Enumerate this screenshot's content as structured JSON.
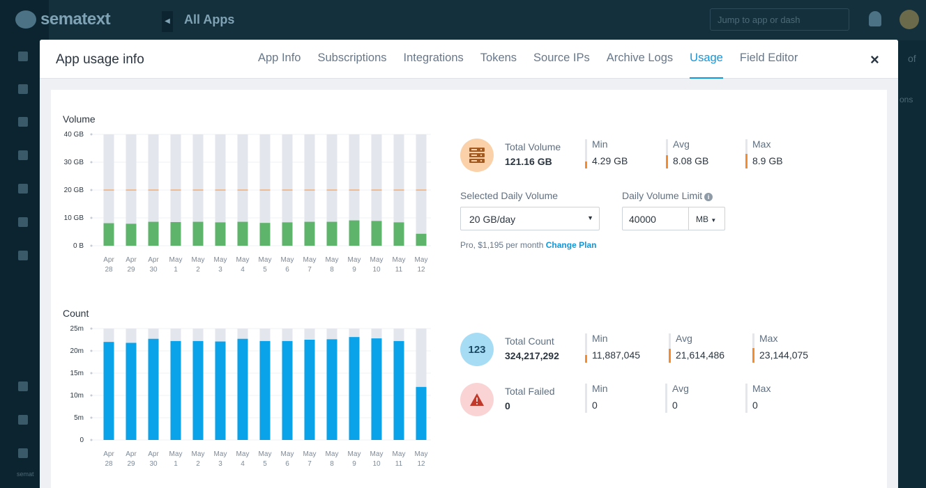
{
  "background": {
    "logo": "sematext",
    "page_title": "All Apps",
    "search_placeholder": "Jump to app or dash",
    "right_text": "of",
    "right_text2": "ons",
    "footer": "semat"
  },
  "modal": {
    "title": "App usage info",
    "tabs": [
      "App Info",
      "Subscriptions",
      "Integrations",
      "Tokens",
      "Source IPs",
      "Archive Logs",
      "Usage",
      "Field Editor"
    ],
    "active_tab": "Usage",
    "close_label": "×"
  },
  "colors": {
    "volume_bar": "#5db46a",
    "count_bar": "#0aa2e8",
    "bar_track": "#e3e6ec",
    "limit_line": "#f5a05a",
    "accent": "#1296db",
    "stat_marker": "#f58b2e"
  },
  "volume": {
    "label": "Volume",
    "stats": {
      "total_title": "Total Volume",
      "total_value": "121.16 GB",
      "min_label": "Min",
      "min_value": "4.29 GB",
      "min_level": 0.48,
      "avg_label": "Avg",
      "avg_value": "8.08 GB",
      "avg_level": 0.91,
      "max_label": "Max",
      "max_value": "8.9 GB",
      "max_level": 1.0
    },
    "icon": "server-icon",
    "selected_daily_label": "Selected Daily Volume",
    "selected_daily_value": "20 GB/day",
    "limit_label": "Daily Volume Limit",
    "limit_value": "40000",
    "limit_unit": "MB",
    "plan_text": "Pro, $1,195 per month",
    "change_plan": "Change Plan"
  },
  "count": {
    "label": "Count",
    "stats": {
      "total_title": "Total Count",
      "total_value": "324,217,292",
      "min_label": "Min",
      "min_value": "11,887,045",
      "min_level": 0.51,
      "avg_label": "Avg",
      "avg_value": "21,614,486",
      "avg_level": 0.93,
      "max_label": "Max",
      "max_value": "23,144,075",
      "max_level": 1.0
    },
    "icon_text": "123",
    "failed": {
      "total_title": "Total Failed",
      "total_value": "0",
      "min_label": "Min",
      "min_value": "0",
      "avg_label": "Avg",
      "avg_value": "0",
      "max_label": "Max",
      "max_value": "0"
    }
  },
  "chart_data": [
    {
      "type": "bar",
      "title": "Volume",
      "categories": [
        [
          "Apr",
          "28"
        ],
        [
          "Apr",
          "29"
        ],
        [
          "Apr",
          "30"
        ],
        [
          "May",
          "1"
        ],
        [
          "May",
          "2"
        ],
        [
          "May",
          "3"
        ],
        [
          "May",
          "4"
        ],
        [
          "May",
          "5"
        ],
        [
          "May",
          "6"
        ],
        [
          "May",
          "7"
        ],
        [
          "May",
          "8"
        ],
        [
          "May",
          "9"
        ],
        [
          "May",
          "10"
        ],
        [
          "May",
          "11"
        ],
        [
          "May",
          "12"
        ]
      ],
      "series": [
        {
          "values": [
            8.1,
            7.9,
            8.6,
            8.5,
            8.6,
            8.4,
            8.6,
            8.2,
            8.4,
            8.6,
            8.6,
            9.1,
            8.9,
            8.4,
            4.3
          ]
        }
      ],
      "y_ticks": [
        "0 B",
        "10 GB",
        "20 GB",
        "30 GB",
        "40 GB"
      ],
      "y_tick_values": [
        0,
        10,
        20,
        30,
        40
      ],
      "ylim": [
        0,
        40
      ],
      "limit_line": 20,
      "grid": true
    },
    {
      "type": "bar",
      "title": "Count",
      "categories": [
        [
          "Apr",
          "28"
        ],
        [
          "Apr",
          "29"
        ],
        [
          "Apr",
          "30"
        ],
        [
          "May",
          "1"
        ],
        [
          "May",
          "2"
        ],
        [
          "May",
          "3"
        ],
        [
          "May",
          "4"
        ],
        [
          "May",
          "5"
        ],
        [
          "May",
          "6"
        ],
        [
          "May",
          "7"
        ],
        [
          "May",
          "8"
        ],
        [
          "May",
          "9"
        ],
        [
          "May",
          "10"
        ],
        [
          "May",
          "11"
        ],
        [
          "May",
          "12"
        ]
      ],
      "series": [
        {
          "values": [
            22.0,
            21.8,
            22.7,
            22.2,
            22.2,
            22.1,
            22.7,
            22.2,
            22.2,
            22.5,
            22.6,
            23.1,
            22.8,
            22.2,
            11.9
          ]
        }
      ],
      "y_ticks": [
        "0",
        "5m",
        "10m",
        "15m",
        "20m",
        "25m"
      ],
      "y_tick_values": [
        0,
        5,
        10,
        15,
        20,
        25
      ],
      "ylim": [
        0,
        25
      ],
      "grid": true
    }
  ]
}
